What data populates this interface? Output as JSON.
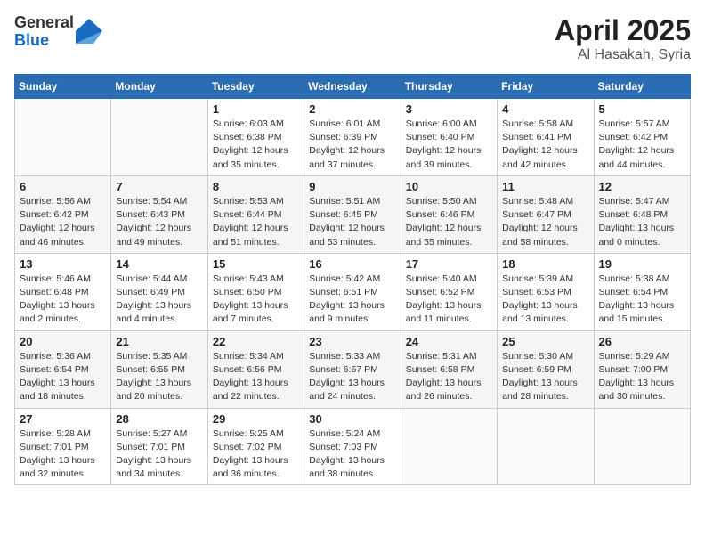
{
  "header": {
    "logo_general": "General",
    "logo_blue": "Blue",
    "month": "April 2025",
    "location": "Al Hasakah, Syria"
  },
  "weekdays": [
    "Sunday",
    "Monday",
    "Tuesday",
    "Wednesday",
    "Thursday",
    "Friday",
    "Saturday"
  ],
  "weeks": [
    [
      {
        "day": "",
        "sunrise": "",
        "sunset": "",
        "daylight": ""
      },
      {
        "day": "",
        "sunrise": "",
        "sunset": "",
        "daylight": ""
      },
      {
        "day": "1",
        "sunrise": "Sunrise: 6:03 AM",
        "sunset": "Sunset: 6:38 PM",
        "daylight": "Daylight: 12 hours and 35 minutes."
      },
      {
        "day": "2",
        "sunrise": "Sunrise: 6:01 AM",
        "sunset": "Sunset: 6:39 PM",
        "daylight": "Daylight: 12 hours and 37 minutes."
      },
      {
        "day": "3",
        "sunrise": "Sunrise: 6:00 AM",
        "sunset": "Sunset: 6:40 PM",
        "daylight": "Daylight: 12 hours and 39 minutes."
      },
      {
        "day": "4",
        "sunrise": "Sunrise: 5:58 AM",
        "sunset": "Sunset: 6:41 PM",
        "daylight": "Daylight: 12 hours and 42 minutes."
      },
      {
        "day": "5",
        "sunrise": "Sunrise: 5:57 AM",
        "sunset": "Sunset: 6:42 PM",
        "daylight": "Daylight: 12 hours and 44 minutes."
      }
    ],
    [
      {
        "day": "6",
        "sunrise": "Sunrise: 5:56 AM",
        "sunset": "Sunset: 6:42 PM",
        "daylight": "Daylight: 12 hours and 46 minutes."
      },
      {
        "day": "7",
        "sunrise": "Sunrise: 5:54 AM",
        "sunset": "Sunset: 6:43 PM",
        "daylight": "Daylight: 12 hours and 49 minutes."
      },
      {
        "day": "8",
        "sunrise": "Sunrise: 5:53 AM",
        "sunset": "Sunset: 6:44 PM",
        "daylight": "Daylight: 12 hours and 51 minutes."
      },
      {
        "day": "9",
        "sunrise": "Sunrise: 5:51 AM",
        "sunset": "Sunset: 6:45 PM",
        "daylight": "Daylight: 12 hours and 53 minutes."
      },
      {
        "day": "10",
        "sunrise": "Sunrise: 5:50 AM",
        "sunset": "Sunset: 6:46 PM",
        "daylight": "Daylight: 12 hours and 55 minutes."
      },
      {
        "day": "11",
        "sunrise": "Sunrise: 5:48 AM",
        "sunset": "Sunset: 6:47 PM",
        "daylight": "Daylight: 12 hours and 58 minutes."
      },
      {
        "day": "12",
        "sunrise": "Sunrise: 5:47 AM",
        "sunset": "Sunset: 6:48 PM",
        "daylight": "Daylight: 13 hours and 0 minutes."
      }
    ],
    [
      {
        "day": "13",
        "sunrise": "Sunrise: 5:46 AM",
        "sunset": "Sunset: 6:48 PM",
        "daylight": "Daylight: 13 hours and 2 minutes."
      },
      {
        "day": "14",
        "sunrise": "Sunrise: 5:44 AM",
        "sunset": "Sunset: 6:49 PM",
        "daylight": "Daylight: 13 hours and 4 minutes."
      },
      {
        "day": "15",
        "sunrise": "Sunrise: 5:43 AM",
        "sunset": "Sunset: 6:50 PM",
        "daylight": "Daylight: 13 hours and 7 minutes."
      },
      {
        "day": "16",
        "sunrise": "Sunrise: 5:42 AM",
        "sunset": "Sunset: 6:51 PM",
        "daylight": "Daylight: 13 hours and 9 minutes."
      },
      {
        "day": "17",
        "sunrise": "Sunrise: 5:40 AM",
        "sunset": "Sunset: 6:52 PM",
        "daylight": "Daylight: 13 hours and 11 minutes."
      },
      {
        "day": "18",
        "sunrise": "Sunrise: 5:39 AM",
        "sunset": "Sunset: 6:53 PM",
        "daylight": "Daylight: 13 hours and 13 minutes."
      },
      {
        "day": "19",
        "sunrise": "Sunrise: 5:38 AM",
        "sunset": "Sunset: 6:54 PM",
        "daylight": "Daylight: 13 hours and 15 minutes."
      }
    ],
    [
      {
        "day": "20",
        "sunrise": "Sunrise: 5:36 AM",
        "sunset": "Sunset: 6:54 PM",
        "daylight": "Daylight: 13 hours and 18 minutes."
      },
      {
        "day": "21",
        "sunrise": "Sunrise: 5:35 AM",
        "sunset": "Sunset: 6:55 PM",
        "daylight": "Daylight: 13 hours and 20 minutes."
      },
      {
        "day": "22",
        "sunrise": "Sunrise: 5:34 AM",
        "sunset": "Sunset: 6:56 PM",
        "daylight": "Daylight: 13 hours and 22 minutes."
      },
      {
        "day": "23",
        "sunrise": "Sunrise: 5:33 AM",
        "sunset": "Sunset: 6:57 PM",
        "daylight": "Daylight: 13 hours and 24 minutes."
      },
      {
        "day": "24",
        "sunrise": "Sunrise: 5:31 AM",
        "sunset": "Sunset: 6:58 PM",
        "daylight": "Daylight: 13 hours and 26 minutes."
      },
      {
        "day": "25",
        "sunrise": "Sunrise: 5:30 AM",
        "sunset": "Sunset: 6:59 PM",
        "daylight": "Daylight: 13 hours and 28 minutes."
      },
      {
        "day": "26",
        "sunrise": "Sunrise: 5:29 AM",
        "sunset": "Sunset: 7:00 PM",
        "daylight": "Daylight: 13 hours and 30 minutes."
      }
    ],
    [
      {
        "day": "27",
        "sunrise": "Sunrise: 5:28 AM",
        "sunset": "Sunset: 7:01 PM",
        "daylight": "Daylight: 13 hours and 32 minutes."
      },
      {
        "day": "28",
        "sunrise": "Sunrise: 5:27 AM",
        "sunset": "Sunset: 7:01 PM",
        "daylight": "Daylight: 13 hours and 34 minutes."
      },
      {
        "day": "29",
        "sunrise": "Sunrise: 5:25 AM",
        "sunset": "Sunset: 7:02 PM",
        "daylight": "Daylight: 13 hours and 36 minutes."
      },
      {
        "day": "30",
        "sunrise": "Sunrise: 5:24 AM",
        "sunset": "Sunset: 7:03 PM",
        "daylight": "Daylight: 13 hours and 38 minutes."
      },
      {
        "day": "",
        "sunrise": "",
        "sunset": "",
        "daylight": ""
      },
      {
        "day": "",
        "sunrise": "",
        "sunset": "",
        "daylight": ""
      },
      {
        "day": "",
        "sunrise": "",
        "sunset": "",
        "daylight": ""
      }
    ]
  ]
}
